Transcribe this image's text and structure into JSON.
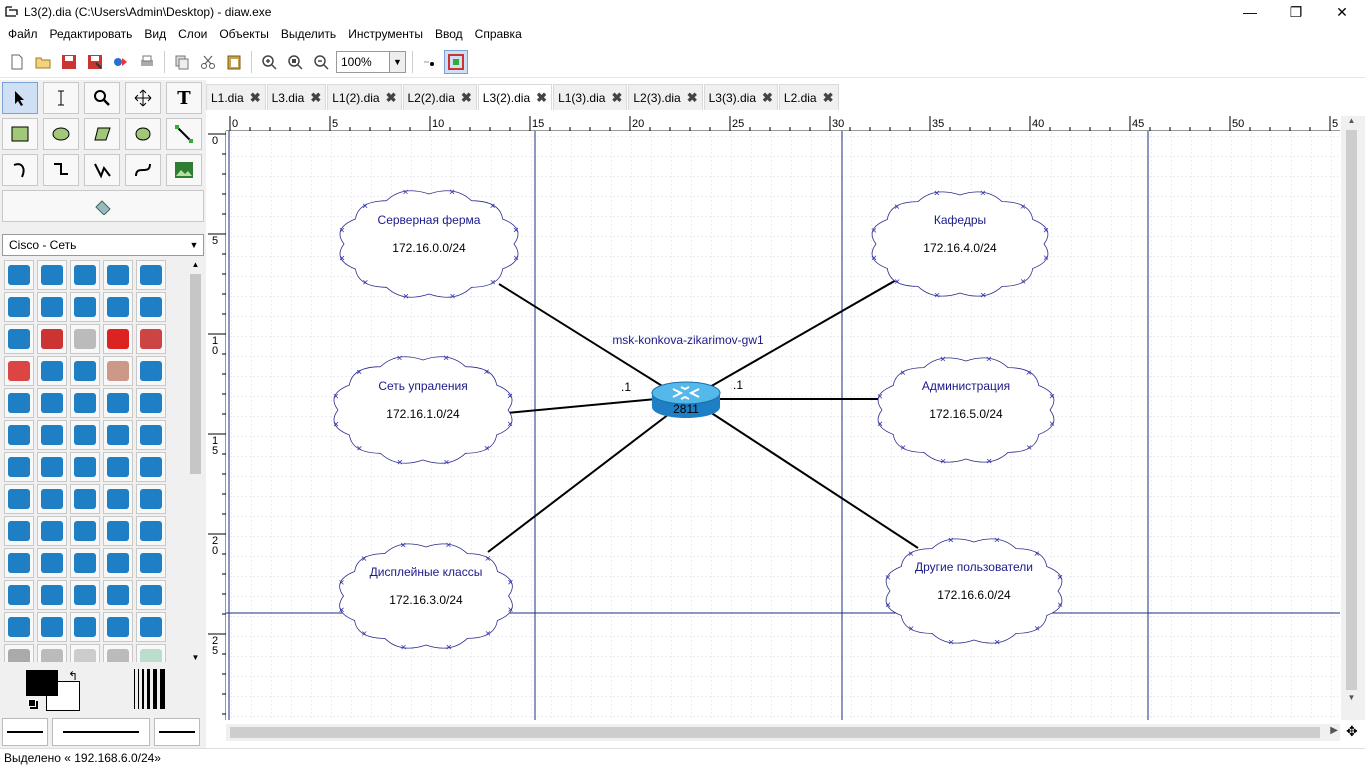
{
  "window": {
    "title": "L3(2).dia (C:\\Users\\Admin\\Desktop) - diaw.exe",
    "minimize": "—",
    "maximize": "❐",
    "close": "✕"
  },
  "menu": [
    "Файл",
    "Редактировать",
    "Вид",
    "Слои",
    "Объекты",
    "Выделить",
    "Инструменты",
    "Ввод",
    "Справка"
  ],
  "toolbar": {
    "zoom_value": "100%"
  },
  "toolbox": {
    "sheet": "Cisco - Сеть",
    "tools": [
      "pointer-tool",
      "text-edit-tool",
      "magnify-tool",
      "scroll-tool",
      "text-tool",
      "box-tool",
      "ellipse-tool",
      "polygon-tool",
      "beziergon-tool",
      "line-tool",
      "arc-tool",
      "zigzag-tool",
      "polyline-tool",
      "bezier-tool",
      "image-tool"
    ],
    "colors": {
      "fg": "#000000",
      "bg": "#ffffff"
    }
  },
  "tabs": [
    {
      "label": "L1.dia",
      "active": false
    },
    {
      "label": "L3.dia",
      "active": false
    },
    {
      "label": "L1(2).dia",
      "active": false
    },
    {
      "label": "L2(2).dia",
      "active": false
    },
    {
      "label": "L3(2).dia",
      "active": true
    },
    {
      "label": "L1(3).dia",
      "active": false
    },
    {
      "label": "L2(3).dia",
      "active": false
    },
    {
      "label": "L3(3).dia",
      "active": false
    },
    {
      "label": "L2.dia",
      "active": false
    }
  ],
  "rulers": {
    "h_ticks": [
      "0",
      "5",
      "10",
      "15",
      "20",
      "25",
      "30",
      "35",
      "40",
      "45",
      "50",
      "5"
    ],
    "v_ticks": [
      "0",
      "5",
      "1\n0",
      "1\n5",
      "2\n0",
      "2\n5"
    ]
  },
  "diagram": {
    "router": {
      "name": "msk-konkova-zikarimov-gw1",
      "model": "2811",
      "label_left": ".1",
      "label_right": ".1"
    },
    "clouds": [
      {
        "id": "server-farm",
        "name": "Серверная ферма",
        "net": "172.16.0.0/24"
      },
      {
        "id": "mgmt",
        "name": "Сеть упраления",
        "net": "172.16.1.0/24"
      },
      {
        "id": "display",
        "name": "Дисплейные классы",
        "net": "172.16.3.0/24"
      },
      {
        "id": "chairs",
        "name": "Кафедры",
        "net": "172.16.4.0/24"
      },
      {
        "id": "admin",
        "name": "Администрация",
        "net": "172.16.5.0/24"
      },
      {
        "id": "others",
        "name": "Другие пользователи",
        "net": "172.16.6.0/24"
      }
    ]
  },
  "status": "Выделено « 192.168.6.0/24»"
}
